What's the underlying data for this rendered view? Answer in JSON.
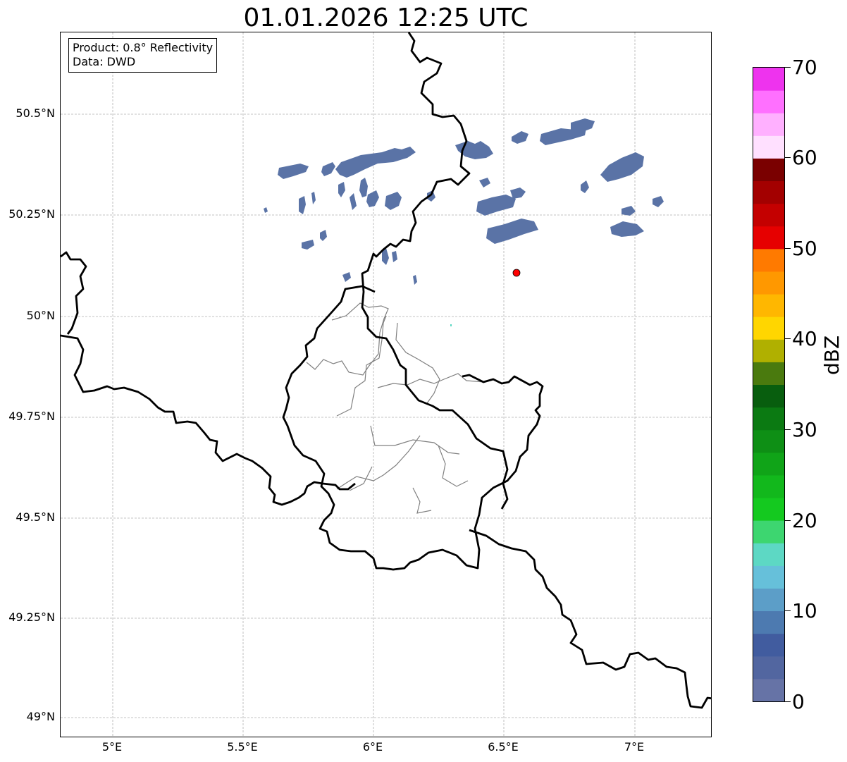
{
  "title": "01.01.2026 12:25 UTC",
  "info": {
    "product": "Product: 0.8° Reflectivity",
    "source": "Data: DWD"
  },
  "map": {
    "lat_labels": [
      "50.5°N",
      "50.25°N",
      "50°N",
      "49.75°N",
      "49.5°N",
      "49.25°N",
      "49°N"
    ],
    "lon_labels": [
      "5°E",
      "5.5°E",
      "6°E",
      "6.5°E",
      "7°E"
    ],
    "radar_site_color": "#ff0000",
    "border_color": "#000000",
    "district_color": "#808080",
    "echo_color": "#5a73a6",
    "grid": true
  },
  "colorbar": {
    "unit": "dBZ",
    "tick_labels": [
      "0",
      "10",
      "20",
      "30",
      "40",
      "50",
      "60",
      "70"
    ],
    "min": 0,
    "max": 70,
    "colors": [
      "#6673a6",
      "#5266a0",
      "#415c9f",
      "#4d7ab0",
      "#5c9ec8",
      "#66c0da",
      "#5dd8c4",
      "#3dd670",
      "#14c91f",
      "#12b81c",
      "#10a418",
      "#0e8f15",
      "#0b7a12",
      "#085e0e",
      "#4a7a0e",
      "#b0b000",
      "#ffd600",
      "#ffb700",
      "#ff9800",
      "#ff7a00",
      "#e60000",
      "#c40000",
      "#a30000",
      "#7a0000",
      "#ffe0ff",
      "#ffb0ff",
      "#ff70ff",
      "#ee33ee"
    ]
  }
}
